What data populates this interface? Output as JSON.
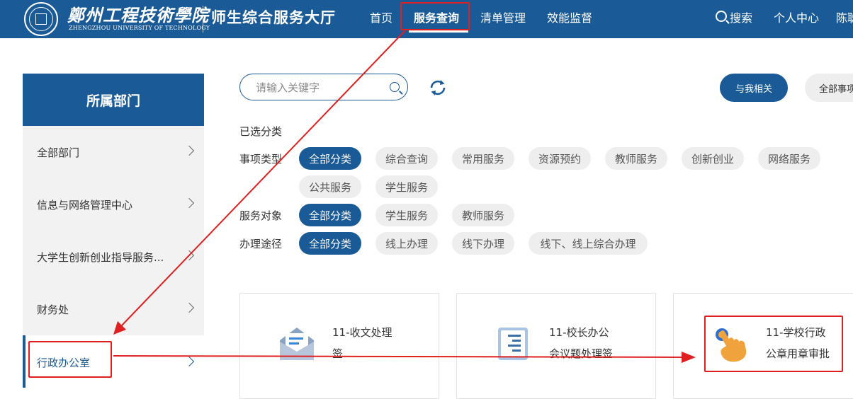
{
  "header": {
    "school_name_cn": "鄭州工程技術學院",
    "school_name_en": "ZHENGZHOU UNIVERSITY OF TECHNOLOGY",
    "portal_title": "师生综合服务大厅",
    "nav": [
      "首页",
      "服务查询",
      "清单管理",
      "效能监督"
    ],
    "active_nav": "服务查询",
    "search_label": "搜索",
    "user_center_label": "个人中心",
    "user_name_partial": "陈聪"
  },
  "sidebar": {
    "title": "所属部门",
    "items": [
      "全部部门",
      "信息与网络管理中心",
      "大学生创新创业指导服务...",
      "财务处"
    ],
    "active_item": "行政办公室"
  },
  "search": {
    "placeholder": "请输入关键字"
  },
  "buttons": {
    "related": "与我相关",
    "all_items": "全部事项"
  },
  "filters": {
    "selected_label": "已选分类",
    "item_type": {
      "label": "事项类型",
      "options": [
        "全部分类",
        "综合查询",
        "常用服务",
        "资源预约",
        "教师服务",
        "创新创业",
        "网络服务",
        "公共服务",
        "学生服务"
      ]
    },
    "audience": {
      "label": "服务对象",
      "options": [
        "全部分类",
        "学生服务",
        "教师服务"
      ]
    },
    "channel": {
      "label": "办理途径",
      "options": [
        "全部分类",
        "线上办理",
        "线下办理",
        "线下、线上综合办理"
      ]
    }
  },
  "cards": [
    {
      "title_line1": "11-收文处理",
      "title_line2": "签",
      "icon": "envelope-icon"
    },
    {
      "title_line1": "11-校长办公",
      "title_line2": "会议题处理签",
      "icon": "document-list-icon"
    },
    {
      "title_line1": "11-学校行政",
      "title_line2": "公章用章审批",
      "icon": "hand-pointer-icon"
    }
  ],
  "colors": {
    "primary": "#1a5a96",
    "annotation": "#e02020",
    "chip_bg": "#eeeeee"
  }
}
